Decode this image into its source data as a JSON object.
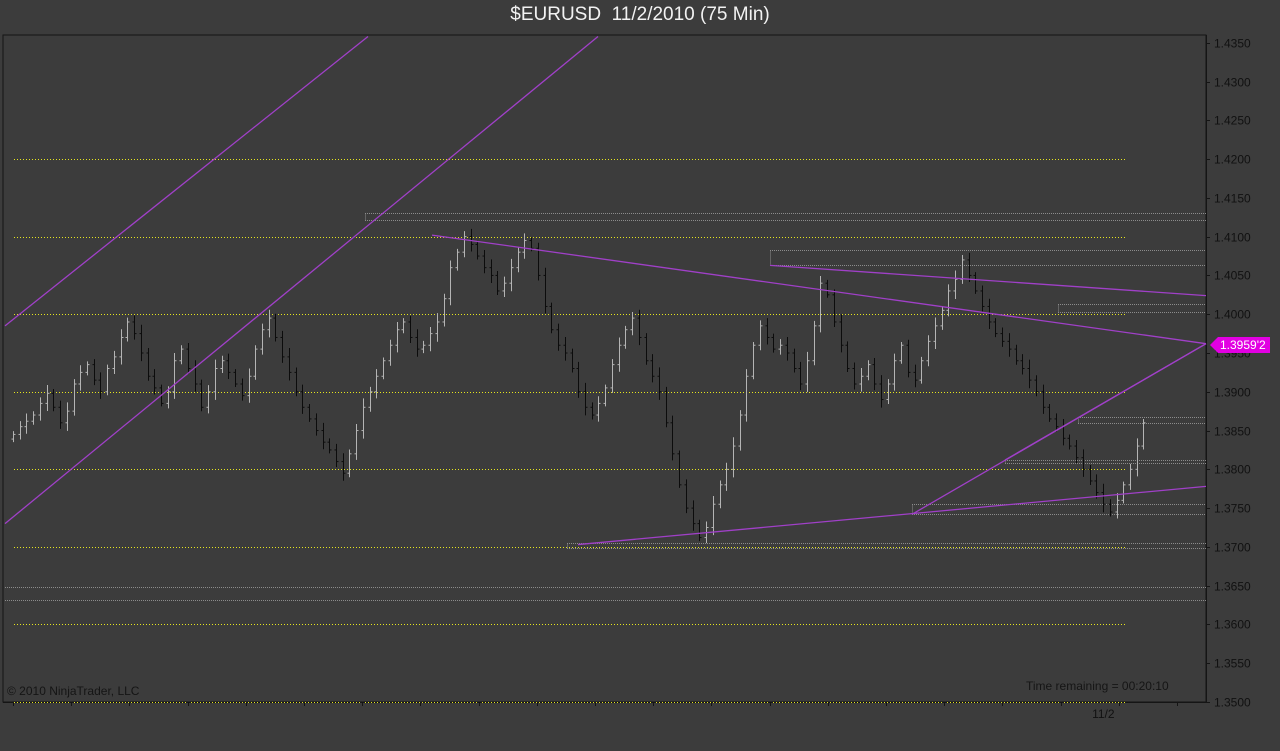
{
  "chart_title": "$EURUSD  11/2/2010 (75 Min)",
  "copyright": "© 2010 NinjaTrader, LLC",
  "time_remaining": "Time remaining = 00:20:10",
  "last_price_label": "1.3959'2",
  "colors": {
    "background": "#3c3c3c",
    "up_bar": "#b4b4b4",
    "down_bar": "#0c0c0c",
    "level_line": "#e6e61e",
    "trend_line": "#a040c8",
    "last_price_badge": "#e200e2"
  },
  "chart_data": {
    "type": "ohlc",
    "title": "$EURUSD  11/2/2010 (75 Min)",
    "ylim": [
      1.35,
      1.436
    ],
    "y_ticks": [
      "1.3500",
      "1.3550",
      "1.3600",
      "1.3650",
      "1.3700",
      "1.3750",
      "1.3800",
      "1.3850",
      "1.3900",
      "1.3950",
      "1.4000",
      "1.4050",
      "1.4100",
      "1.4150",
      "1.4200",
      "1.4250",
      "1.4300",
      "1.4350"
    ],
    "x_labels": [
      {
        "label": "11/2",
        "bar": 162
      }
    ],
    "bar_count": 167,
    "grid": false,
    "last_price": 1.39592,
    "close_series": [
      1.3845,
      1.3855,
      1.3862,
      1.387,
      1.3885,
      1.3898,
      1.388,
      1.386,
      1.3875,
      1.391,
      1.3925,
      1.3935,
      1.3915,
      1.39,
      1.393,
      1.3945,
      1.397,
      1.399,
      1.3975,
      1.395,
      1.392,
      1.3905,
      1.3885,
      1.39,
      1.394,
      1.3955,
      1.393,
      1.391,
      1.388,
      1.39,
      1.393,
      1.394,
      1.3925,
      1.391,
      1.3895,
      1.392,
      1.3955,
      1.398,
      1.3995,
      1.397,
      1.3945,
      1.3925,
      1.39,
      1.388,
      1.3865,
      1.385,
      1.3835,
      1.3825,
      1.381,
      1.3795,
      1.382,
      1.385,
      1.388,
      1.39,
      1.392,
      1.394,
      1.396,
      1.398,
      1.399,
      1.397,
      1.3955,
      1.396,
      1.3975,
      1.399,
      1.402,
      1.406,
      1.408,
      1.41,
      1.409,
      1.4075,
      1.406,
      1.405,
      1.403,
      1.404,
      1.406,
      1.408,
      1.4095,
      1.4085,
      1.405,
      1.401,
      1.398,
      1.396,
      1.395,
      1.393,
      1.39,
      1.388,
      1.387,
      1.3885,
      1.3905,
      1.3935,
      1.396,
      1.398,
      1.3995,
      1.397,
      1.394,
      1.392,
      1.39,
      1.386,
      1.382,
      1.378,
      1.375,
      1.373,
      1.3712,
      1.3725,
      1.3755,
      1.378,
      1.38,
      1.383,
      1.387,
      1.392,
      1.396,
      1.3985,
      1.397,
      1.3955,
      1.396,
      1.395,
      1.393,
      1.391,
      1.394,
      1.3985,
      1.404,
      1.4025,
      1.399,
      1.396,
      1.393,
      1.391,
      1.392,
      1.3935,
      1.391,
      1.389,
      1.391,
      1.394,
      1.396,
      1.3925,
      1.3915,
      1.394,
      1.3965,
      1.3985,
      1.4005,
      1.403,
      1.4045,
      1.407,
      1.405,
      1.403,
      1.401,
      1.399,
      1.3975,
      1.3965,
      1.3955,
      1.394,
      1.393,
      1.3915,
      1.39,
      1.388,
      1.3865,
      1.3855,
      1.384,
      1.383,
      1.3815,
      1.38,
      1.3785,
      1.377,
      1.3755,
      1.3745,
      1.376,
      1.378,
      1.38,
      1.383,
      1.386
    ]
  }
}
